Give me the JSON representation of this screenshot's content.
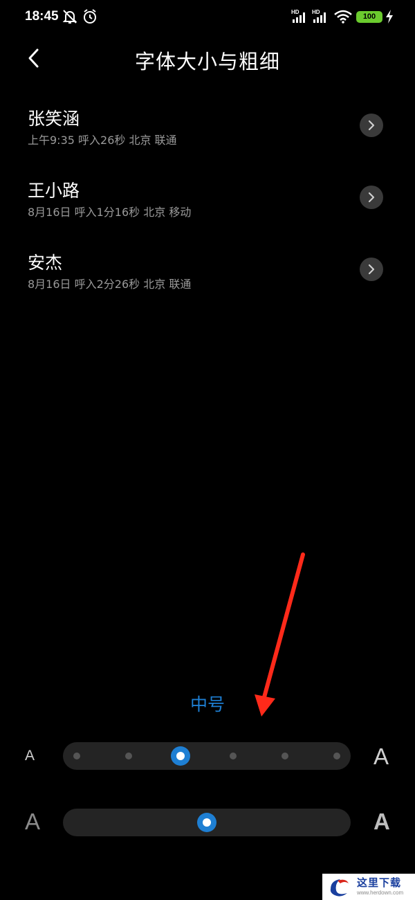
{
  "status_bar": {
    "time": "18:45",
    "battery": "100",
    "icons": [
      "bell-off-icon",
      "alarm-icon",
      "hd-signal-icon",
      "hd-signal-icon",
      "wifi-icon",
      "battery-icon",
      "charging-icon"
    ]
  },
  "header": {
    "title": "字体大小与粗细",
    "back_icon": "back-arrow-icon"
  },
  "calls": [
    {
      "name": "张笑涵",
      "detail": "上午9:35 呼入26秒 北京 联通"
    },
    {
      "name": "王小路",
      "detail": "8月16日 呼入1分16秒 北京 移动"
    },
    {
      "name": "安杰",
      "detail": "8月16日 呼入2分26秒 北京 联通"
    }
  ],
  "font_size": {
    "selected_label": "中号",
    "steps": 6,
    "selected_index": 2,
    "small_glyph": "A",
    "large_glyph": "A"
  },
  "font_weight": {
    "level": 0.5,
    "light_glyph": "A",
    "bold_glyph": "A"
  },
  "watermark": {
    "text": "这里下载",
    "url": "www.herdown.com"
  },
  "colors": {
    "accent": "#1e7fd3",
    "background": "#000000",
    "arrow": "#ff2a1a",
    "battery": "#6bcb2e"
  }
}
